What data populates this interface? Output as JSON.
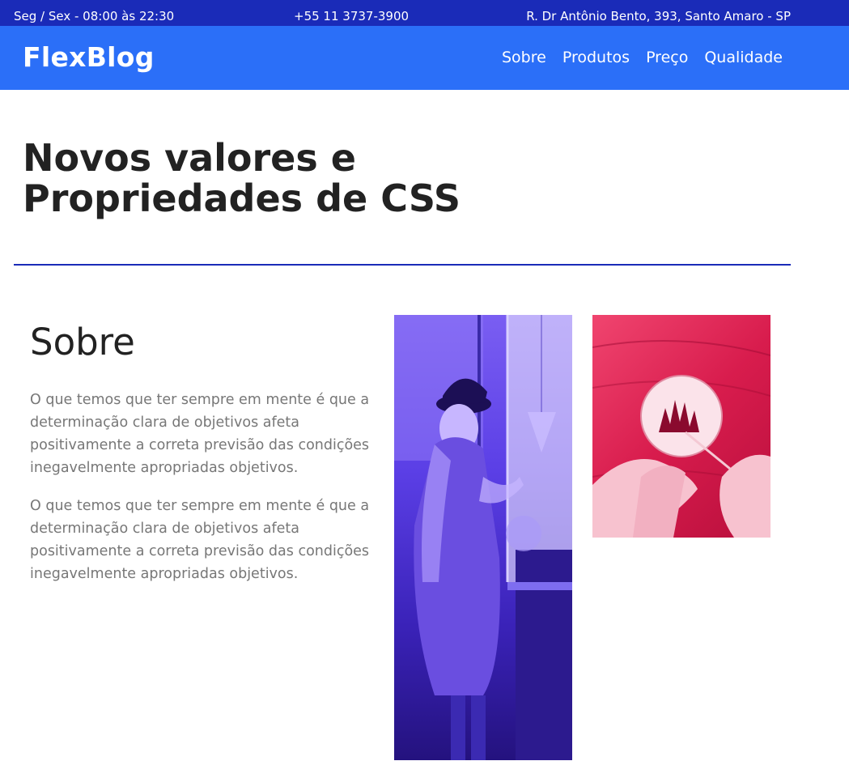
{
  "topbar": {
    "hours": "Seg / Sex - 08:00 às 22:30",
    "phone": "+55 11 3737-3900",
    "address": "R. Dr Antônio Bento, 393, Santo Amaro - SP"
  },
  "navbar": {
    "logo": "FlexBlog",
    "links": [
      "Sobre",
      "Produtos",
      "Preço",
      "Qualidade"
    ]
  },
  "hero": {
    "title": "Novos valores e Propriedades de CSS"
  },
  "about": {
    "title": "Sobre",
    "paragraphs": [
      "O que temos que ter sempre em mente é que a determinação clara de objetivos afeta positivamente a correta previsão das condições inegavelmente apropriadas objetivos.",
      "O que temos que ter sempre em mente é que a determinação clara de objetivos afeta positivamente a correta previsão das condições inegavelmente apropriadas objetivos."
    ]
  },
  "colors": {
    "topbar_bg": "#1a2bb8",
    "navbar_bg": "#2b6ff8",
    "divider": "#1a2bb8",
    "body_text": "#777777",
    "heading_text": "#222222"
  }
}
